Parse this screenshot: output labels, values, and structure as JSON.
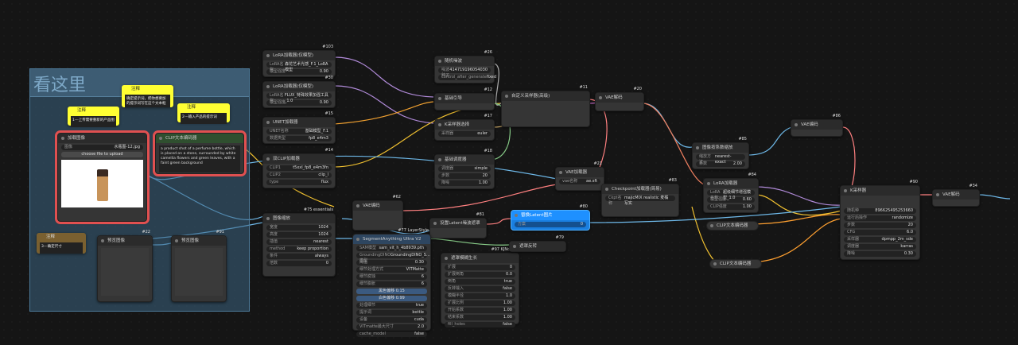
{
  "group": {
    "title": "看这里"
  },
  "notes": [
    {
      "id": "n1",
      "title": "注释",
      "text": "确定提示词，把你想要加的提示词写在这个文本框"
    },
    {
      "id": "n2",
      "title": "注释",
      "text": "1---上传需要重新的产品图"
    },
    {
      "id": "n3",
      "title": "注释",
      "text": "2---输入产品的提示词"
    },
    {
      "id": "n4",
      "title": "注释",
      "text": "3---确定尺寸"
    }
  ],
  "load_image": {
    "title": "加载图像",
    "image_label": "图像",
    "image_value": "水瓶图-12.jpg",
    "upload": "choose file to upload"
  },
  "clip_text": {
    "title": "CLIP文本编码器",
    "text": "a product shot of a perfume bottle, which is placed on a stone, surrounded by white camellia flowers and green leaves, with a faint green background"
  },
  "nodes": {
    "lora1": {
      "id": "#103",
      "title": "LoRA加载器(仅模型)",
      "rows": [
        [
          "LoRA名称",
          "森花艺术光感_F.1_LoRA模型"
        ],
        [
          "模型强度",
          "0.90"
        ]
      ]
    },
    "lora2": {
      "id": "#30",
      "title": "LoRA加载器(仅模型)",
      "rows": [
        [
          "LoRA名称",
          "FLUX_特殊效果加强工具_1.0"
        ],
        [
          "模型强度",
          "0.90"
        ]
      ]
    },
    "unet": {
      "id": "#15",
      "title": "UNET加载器",
      "rows": [
        [
          "UNET名称",
          "基础模型_F.1"
        ],
        [
          "数据类型",
          "fp8_e4m3"
        ]
      ]
    },
    "dualclip": {
      "id": "#14",
      "title": "双CLIP加载器",
      "rows": [
        [
          "CLIP1",
          "t5xxl_fp8_e4m3fn"
        ],
        [
          "CLIP2",
          "clip_l"
        ],
        [
          "type",
          "flux"
        ]
      ]
    },
    "noise": {
      "id": "#26",
      "title": "随机噪波",
      "rows": [
        [
          "噪波种子",
          "414719196054030"
        ],
        [
          "control_after_generate",
          "fixed"
        ]
      ]
    },
    "guider": {
      "id": "#12",
      "title": "基础引导",
      "rows": []
    },
    "ksampler_sel": {
      "id": "#17",
      "title": "K采样器选择",
      "rows": [
        [
          "采样器",
          "euler"
        ]
      ]
    },
    "sched": {
      "id": "#18",
      "title": "基础调度器",
      "rows": [
        [
          "调度器",
          "simple"
        ],
        [
          "步数",
          "20"
        ],
        [
          "降噪",
          "1.00"
        ]
      ]
    },
    "custom_sampler": {
      "id": "#11",
      "title": "自定义采样器(高级)",
      "rows": []
    },
    "vaedec1": {
      "id": "#20",
      "title": "VAE解码",
      "rows": []
    },
    "vaeload": {
      "id": "#21",
      "title": "VAE加载器",
      "rows": [
        [
          "vae名称",
          "ae.sft"
        ]
      ]
    },
    "vaeenc": {
      "id": "#62",
      "title": "VAE编码",
      "rows": []
    },
    "resize": {
      "id": "#75 essentials",
      "title": "图像缩放",
      "rows": [
        [
          "宽度",
          "1024"
        ],
        [
          "高度",
          "1024"
        ],
        [
          "插值",
          "nearest"
        ],
        [
          "method",
          "keep proportion"
        ],
        [
          "条件",
          "always"
        ],
        [
          "倍数",
          "0"
        ]
      ]
    },
    "latentmask": {
      "id": "#81",
      "title": "设置Latent噪波遮罩",
      "rows": []
    },
    "segment": {
      "id": "#77 LayerStyle",
      "title": "SegmentAnything Ultra V2",
      "rows": [
        [
          "SAM模型",
          "sam_vit_h_4b8939.pth"
        ],
        [
          "GroundingDINO模型",
          "GroundingDINO_S..."
        ],
        [
          "阈值",
          "0.30"
        ],
        [
          "细节处理方式",
          "VITMatte"
        ],
        [
          "细节腐蚀",
          "6"
        ],
        [
          "细节膨胀",
          "6"
        ]
      ],
      "sliders": [
        "黑色偏移 0.15",
        "白色偏移 0.99"
      ],
      "rows2": [
        [
          "处理细节",
          "true"
        ],
        [
          "提示词",
          "bottle"
        ],
        [
          "设备",
          "cuda"
        ],
        [
          "VITmatte最大尺寸",
          "2.0"
        ],
        [
          "cache_model",
          "false"
        ]
      ]
    },
    "grow_mask": {
      "id": "#97 KJNodes",
      "title": "遮罩模糊生长",
      "rows": [
        [
          "扩展",
          "0"
        ],
        [
          "扩展倒角",
          "0.0"
        ],
        [
          "倒角",
          "true"
        ],
        [
          "反转输入",
          "false"
        ],
        [
          "模糊半径",
          "1.0"
        ],
        [
          "扩展比例",
          "1.00"
        ],
        [
          "开始系数",
          "1.00"
        ],
        [
          "结束系数",
          "1.00"
        ],
        [
          "fill_holes",
          "false"
        ]
      ]
    },
    "invert": {
      "id": "#79",
      "title": "遮罩反转",
      "rows": []
    },
    "preview1": {
      "id": "#22",
      "title": "预览图像",
      "rows": []
    },
    "preview2": {
      "id": "#91",
      "title": "预览图像",
      "rows": []
    },
    "latent_blue": {
      "id": "#80",
      "title": "替换Latent图片",
      "rows": [
        [
          "方案",
          "0"
        ]
      ]
    },
    "ckpt": {
      "id": "#83",
      "title": "Checkpoint加载器(简易)",
      "rows": [
        [
          "Ckpt名称",
          "majicMIX realistic 麦橘写实"
        ]
      ]
    },
    "upscale": {
      "id": "#85",
      "title": "图像按系数缩放",
      "rows": [
        [
          "缩放方法",
          "nearest-exact"
        ],
        [
          "系数",
          "2.00"
        ]
      ]
    },
    "lora3": {
      "id": "#84",
      "title": "LoRA加载器",
      "rows": [
        [
          "LoRA名称",
          "超级细节增强模型_1.0"
        ],
        [
          "模型强度",
          "0.60"
        ],
        [
          "CLIP强度",
          "1.00"
        ]
      ]
    },
    "vaeenc2": {
      "id": "#86",
      "title": "VAE编码",
      "rows": []
    },
    "clip_enc1": {
      "id": "#92",
      "title": "CLIP文本编码器",
      "rows": []
    },
    "clip_enc2": {
      "id": "#93",
      "title": "CLIP文本编码器",
      "rows": []
    },
    "ksampler": {
      "id": "#90",
      "title": "K采样器",
      "rows": [
        [
          "随机种",
          "896625495253660"
        ],
        [
          "运行后操作",
          "randomize"
        ],
        [
          "步数",
          "20"
        ],
        [
          "CFG",
          "6.0"
        ],
        [
          "采样器",
          "dpmpp_2m_sde"
        ],
        [
          "调度器",
          "karras"
        ],
        [
          "降噪",
          "0.30"
        ]
      ]
    },
    "vaedec2": {
      "id": "#34",
      "title": "VAE解码",
      "rows": []
    }
  }
}
